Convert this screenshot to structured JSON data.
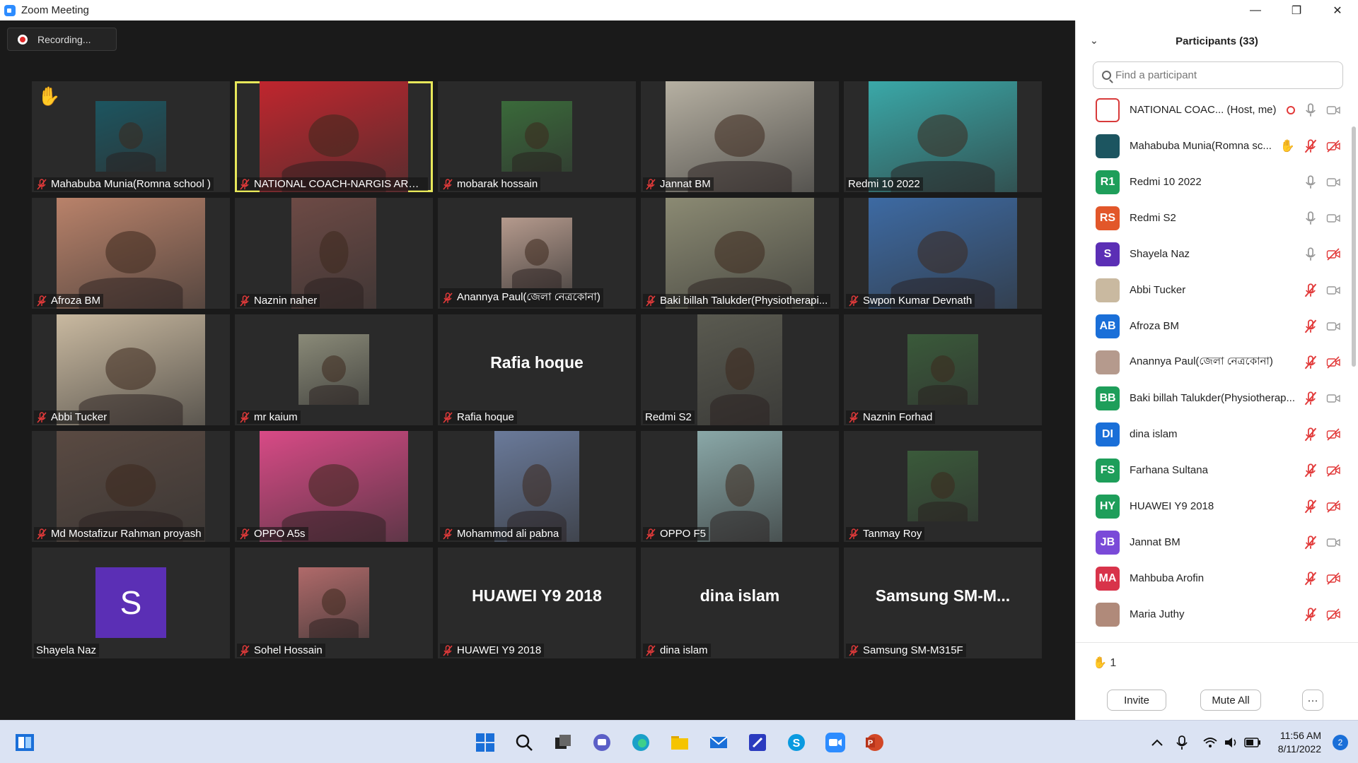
{
  "window": {
    "title": "Zoom Meeting"
  },
  "recording": {
    "label": "Recording..."
  },
  "tiles": [
    {
      "name": "Mahabuba Munia(Romna school )",
      "muted": true,
      "kind": "image",
      "bg": "#1c5560",
      "hand": true
    },
    {
      "name": "NATIONAL COACH-NARGIS ARA AN...",
      "muted": true,
      "kind": "video",
      "bg": "#c0262e",
      "active": true
    },
    {
      "name": "mobarak hossain",
      "muted": true,
      "kind": "image",
      "bg": "#3a6a3a"
    },
    {
      "name": "Jannat BM",
      "muted": true,
      "kind": "video",
      "bg": "#b6b0a2"
    },
    {
      "name": "Redmi 10 2022",
      "muted": false,
      "kind": "video",
      "bg": "#3aa8a8"
    },
    {
      "name": "Afroza BM",
      "muted": true,
      "kind": "video",
      "bg": "#b9826a"
    },
    {
      "name": "Naznin naher",
      "muted": true,
      "kind": "video3",
      "bg": "#6d4a45"
    },
    {
      "name": "Anannya Paul(জেলা নেত্রকোনা)",
      "muted": true,
      "kind": "image",
      "bg": "#b59a8d"
    },
    {
      "name": "Baki billah Talukder(Physiotherapi...",
      "muted": true,
      "kind": "video",
      "bg": "#8b8a73"
    },
    {
      "name": "Swpon Kumar Devnath",
      "muted": true,
      "kind": "video",
      "bg": "#3d6aa3"
    },
    {
      "name": "Abbi Tucker",
      "muted": true,
      "kind": "video",
      "bg": "#c9b9a0"
    },
    {
      "name": "mr kaium",
      "muted": true,
      "kind": "image",
      "bg": "#8a8a78"
    },
    {
      "name": "Rafia hoque",
      "muted": true,
      "kind": "text",
      "display": "Rafia hoque"
    },
    {
      "name": "Redmi S2",
      "muted": false,
      "kind": "video3",
      "bg": "#5a5a50"
    },
    {
      "name": "Naznin Forhad",
      "muted": true,
      "kind": "image",
      "bg": "#3a5a3a"
    },
    {
      "name": "Md Mostafizur Rahman proyash",
      "muted": true,
      "kind": "video",
      "bg": "#5a4a42"
    },
    {
      "name": "OPPO A5s",
      "muted": true,
      "kind": "video",
      "bg": "#d84a86"
    },
    {
      "name": "Mohammod ali pabna",
      "muted": true,
      "kind": "video3",
      "bg": "#6a7a9a"
    },
    {
      "name": "OPPO F5",
      "muted": true,
      "kind": "video3",
      "bg": "#8aa8a8"
    },
    {
      "name": "Tanmay Roy",
      "muted": true,
      "kind": "image",
      "bg": "#3a5a3a"
    },
    {
      "name": "Shayela Naz",
      "muted": false,
      "kind": "avatar",
      "letter": "S",
      "bg": "#5b2fb5"
    },
    {
      "name": "Sohel Hossain",
      "muted": true,
      "kind": "image",
      "bg": "#b06a6a"
    },
    {
      "name": "HUAWEI Y9 2018",
      "muted": true,
      "kind": "text",
      "display": "HUAWEI Y9 2018"
    },
    {
      "name": "dina islam",
      "muted": true,
      "kind": "text",
      "display": "dina islam"
    },
    {
      "name": "Samsung SM-M315F",
      "muted": true,
      "kind": "text",
      "display": "Samsung SM-M..."
    }
  ],
  "participants_panel": {
    "title": "Participants (33)",
    "search_placeholder": "Find a participant",
    "items": [
      {
        "name": "NATIONAL COAC...  (Host, me)",
        "initials": "",
        "color": "#ffffff",
        "mic": "on",
        "video": "on",
        "rec": true
      },
      {
        "name": "Mahabuba Munia(Romna sc...",
        "initials": "",
        "color": "#1c5560",
        "mic": "off",
        "video": "off",
        "hand": true
      },
      {
        "name": "Redmi 10 2022",
        "initials": "R1",
        "color": "#1e9e5a",
        "mic": "on",
        "video": "on"
      },
      {
        "name": "Redmi S2",
        "initials": "RS",
        "color": "#e2572a",
        "mic": "on",
        "video": "on"
      },
      {
        "name": "Shayela Naz",
        "initials": "S",
        "color": "#5b2fb5",
        "mic": "on",
        "video": "off"
      },
      {
        "name": "Abbi Tucker",
        "initials": "",
        "color": "#c9b9a0",
        "mic": "off",
        "video": "on"
      },
      {
        "name": "Afroza BM",
        "initials": "AB",
        "color": "#1a6fd8",
        "mic": "off",
        "video": "on"
      },
      {
        "name": "Anannya Paul(জেলা নেত্রকোনা)",
        "initials": "",
        "color": "#b59a8d",
        "mic": "off",
        "video": "off"
      },
      {
        "name": "Baki billah Talukder(Physiotherap...",
        "initials": "BB",
        "color": "#1e9e5a",
        "mic": "off",
        "video": "on"
      },
      {
        "name": "dina islam",
        "initials": "DI",
        "color": "#1a6fd8",
        "mic": "off",
        "video": "off"
      },
      {
        "name": "Farhana Sultana",
        "initials": "FS",
        "color": "#1e9e5a",
        "mic": "off",
        "video": "off"
      },
      {
        "name": "HUAWEI Y9 2018",
        "initials": "HY",
        "color": "#1e9e5a",
        "mic": "off",
        "video": "off"
      },
      {
        "name": "Jannat BM",
        "initials": "JB",
        "color": "#7a4ad8",
        "mic": "off",
        "video": "on"
      },
      {
        "name": "Mahbuba Arofin",
        "initials": "MA",
        "color": "#d8334a",
        "mic": "off",
        "video": "off"
      },
      {
        "name": "Maria Juthy",
        "initials": "",
        "color": "#b08a7a",
        "mic": "off",
        "video": "off"
      }
    ],
    "raised_hands": "1",
    "invite_label": "Invite",
    "mute_all_label": "Mute All",
    "more_label": "···"
  },
  "taskbar": {
    "time": "11:56 AM",
    "date": "8/11/2022",
    "notifications": "2"
  }
}
